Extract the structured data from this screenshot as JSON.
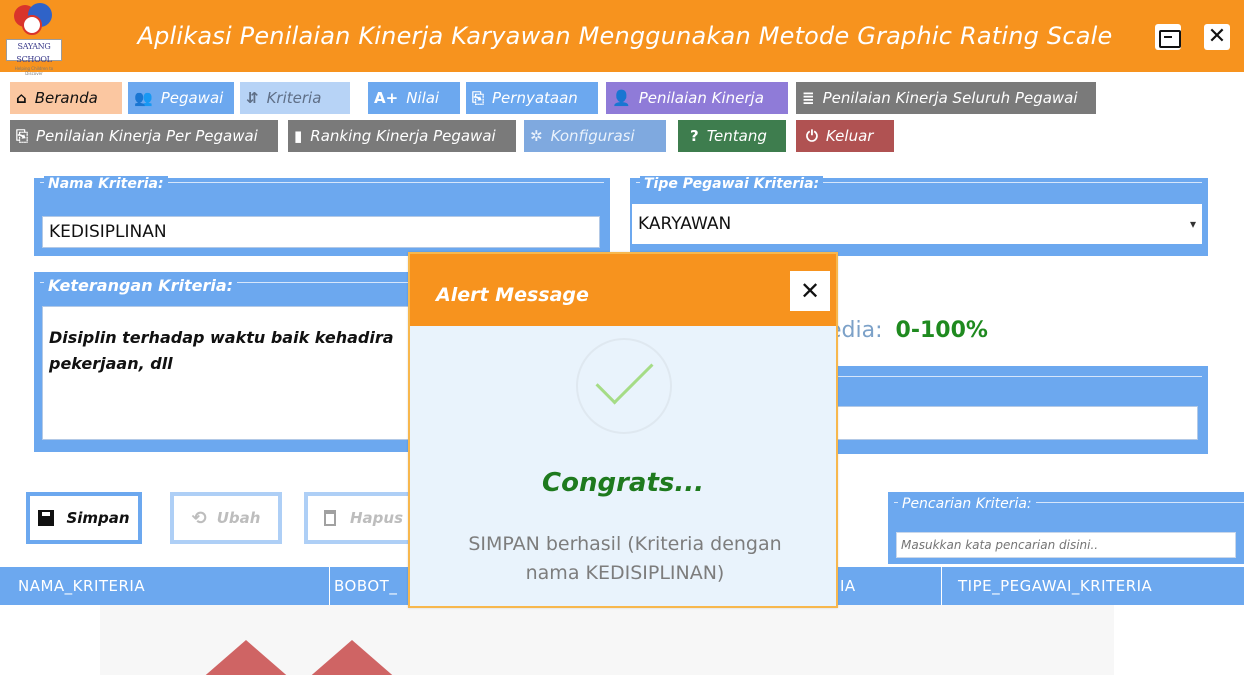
{
  "window": {
    "title": "Aplikasi Penilaian Kinerja Karyawan Menggunakan Metode Graphic Rating Scale",
    "logo_text": "SAYANG SCHOOL",
    "logo_subtext": "Helping Children to Discover",
    "minimize_glyph": "▭",
    "close_glyph": "✕"
  },
  "menu": {
    "row1": [
      {
        "label": "Beranda",
        "icon": "⌂",
        "icon_name": "home-icon",
        "bg": "#fbc7a1",
        "fg": "#111111"
      },
      {
        "label": "Pegawai",
        "icon": "👥",
        "icon_name": "users-icon",
        "bg": "#6ca8ef",
        "fg": "#ffffff"
      },
      {
        "label": "Kriteria",
        "icon": "⇵",
        "icon_name": "sort-az-icon",
        "bg": "#b7d3f6",
        "fg": "#5f6f87"
      },
      {
        "label": "Nilai",
        "icon": "A+",
        "icon_name": "grade-icon",
        "bg": "#6ca8ef",
        "fg": "#ffffff"
      },
      {
        "label": "Pernyataan",
        "icon": "⎘",
        "icon_name": "document-icon",
        "bg": "#6ca8ef",
        "fg": "#ffffff"
      },
      {
        "label": "Penilaian Kinerja",
        "icon": "👤",
        "icon_name": "person-icon",
        "bg": "#8f7bd8",
        "fg": "#ffffff"
      },
      {
        "label": "Penilaian Kinerja Seluruh Pegawai",
        "icon": "≣",
        "icon_name": "report-icon",
        "bg": "#7a7a7a",
        "fg": "#ffffff"
      }
    ],
    "row2": [
      {
        "label": "Penilaian Kinerja Per Pegawai",
        "icon": "⎘",
        "icon_name": "document-icon",
        "bg": "#7a7a7a",
        "fg": "#ffffff"
      },
      {
        "label": "Ranking Kinerja Pegawai",
        "icon": "▮",
        "icon_name": "ranking-icon",
        "bg": "#7a7a7a",
        "fg": "#ffffff"
      },
      {
        "label": "Konfigurasi",
        "icon": "✲",
        "icon_name": "gear-icon",
        "bg": "#7fa9df",
        "fg": "#eaf2fc"
      },
      {
        "label": "Tentang",
        "icon": "?",
        "icon_name": "question-icon",
        "bg": "#3e7d4e",
        "fg": "#ffffff"
      },
      {
        "label": "Keluar",
        "icon": "⏻",
        "icon_name": "power-icon",
        "bg": "#b05252",
        "fg": "#ffffff"
      }
    ]
  },
  "form": {
    "nama_kriteria": {
      "label": "Nama Kriteria:",
      "value": "KEDISIPLINAN"
    },
    "tipe_pegawai": {
      "label": "Tipe Pegawai Kriteria:",
      "value": "KARYAWAN",
      "dropdown_glyph": "▾"
    },
    "keterangan": {
      "label": "Keterangan Kriteria:",
      "value": "Disiplin terhadap waktu baik kehadira",
      "value2": "pekerjaan, dll"
    },
    "media": {
      "label": "edia:",
      "value": "0-100%"
    }
  },
  "actions": {
    "simpan": {
      "label": "Simpan",
      "icon": "💾"
    },
    "ubah": {
      "label": "Ubah",
      "icon": "⟲"
    },
    "hapus": {
      "label": "Hapus",
      "icon": "🗑"
    }
  },
  "search": {
    "label": "Pencarian Kriteria:",
    "placeholder": "Masukkan kata pencarian disini.."
  },
  "table": {
    "columns": [
      "NAMA_KRITERIA",
      "BOBOT_",
      "IA",
      "TIPE_PEGAWAI_KRITERIA"
    ]
  },
  "alert": {
    "title": "Alert Message",
    "close_glyph": "✕",
    "heading": "Congrats...",
    "message_line1": "SIMPAN berhasil (Kriteria dengan",
    "message_line2": "nama KEDISIPLINAN)"
  }
}
